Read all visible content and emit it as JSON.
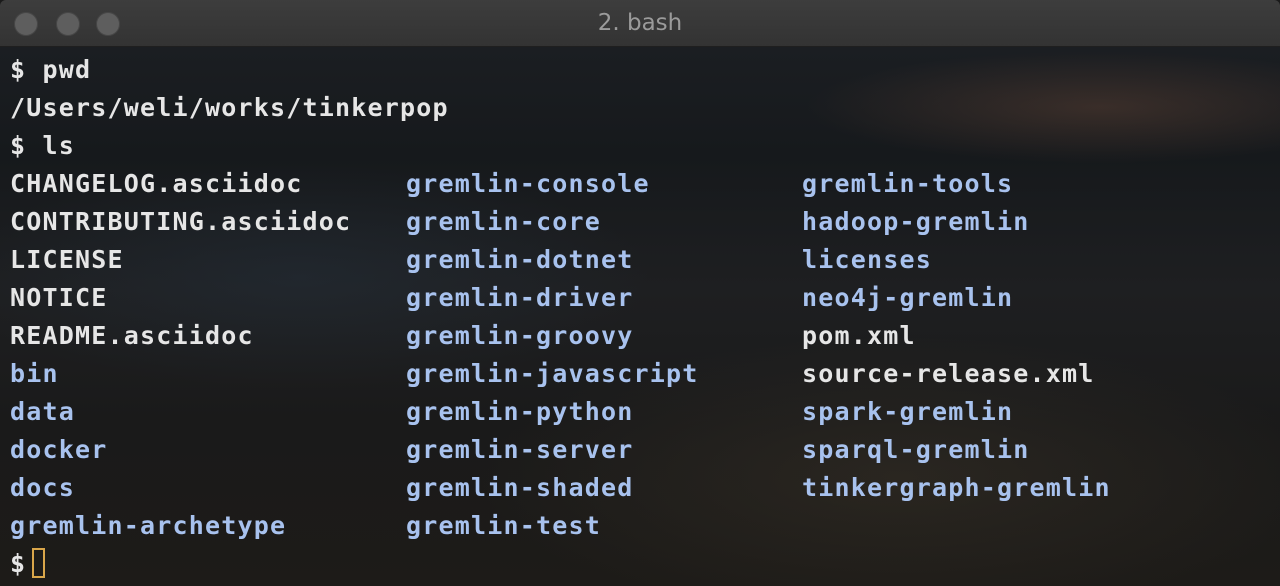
{
  "window": {
    "title": "2. bash"
  },
  "terminal": {
    "prompt_symbol": "$",
    "commands": [
      {
        "prompt": "$",
        "command": "pwd"
      },
      {
        "prompt": "$",
        "command": "ls"
      }
    ],
    "pwd_output": "/Users/weli/works/tinkerpop",
    "ls_entries": {
      "col1": [
        {
          "name": "CHANGELOG.asciidoc",
          "kind": "file"
        },
        {
          "name": "CONTRIBUTING.asciidoc",
          "kind": "file"
        },
        {
          "name": "LICENSE",
          "kind": "file"
        },
        {
          "name": "NOTICE",
          "kind": "file"
        },
        {
          "name": "README.asciidoc",
          "kind": "file"
        },
        {
          "name": "bin",
          "kind": "dir"
        },
        {
          "name": "data",
          "kind": "dir"
        },
        {
          "name": "docker",
          "kind": "dir"
        },
        {
          "name": "docs",
          "kind": "dir"
        },
        {
          "name": "gremlin-archetype",
          "kind": "dir"
        }
      ],
      "col2": [
        {
          "name": "gremlin-console",
          "kind": "dir"
        },
        {
          "name": "gremlin-core",
          "kind": "dir"
        },
        {
          "name": "gremlin-dotnet",
          "kind": "dir"
        },
        {
          "name": "gremlin-driver",
          "kind": "dir"
        },
        {
          "name": "gremlin-groovy",
          "kind": "dir"
        },
        {
          "name": "gremlin-javascript",
          "kind": "dir"
        },
        {
          "name": "gremlin-python",
          "kind": "dir"
        },
        {
          "name": "gremlin-server",
          "kind": "dir"
        },
        {
          "name": "gremlin-shaded",
          "kind": "dir"
        },
        {
          "name": "gremlin-test",
          "kind": "dir"
        }
      ],
      "col3": [
        {
          "name": "gremlin-tools",
          "kind": "dir"
        },
        {
          "name": "hadoop-gremlin",
          "kind": "dir"
        },
        {
          "name": "licenses",
          "kind": "dir"
        },
        {
          "name": "neo4j-gremlin",
          "kind": "dir"
        },
        {
          "name": "pom.xml",
          "kind": "file"
        },
        {
          "name": "source-release.xml",
          "kind": "file"
        },
        {
          "name": "spark-gremlin",
          "kind": "dir"
        },
        {
          "name": "sparql-gremlin",
          "kind": "dir"
        },
        {
          "name": "tinkergraph-gremlin",
          "kind": "dir"
        }
      ]
    },
    "final_prompt": "$",
    "colors": {
      "file": "#e6e6e6",
      "dir": "#a8c2ee",
      "cursor": "#d9a64a"
    }
  }
}
